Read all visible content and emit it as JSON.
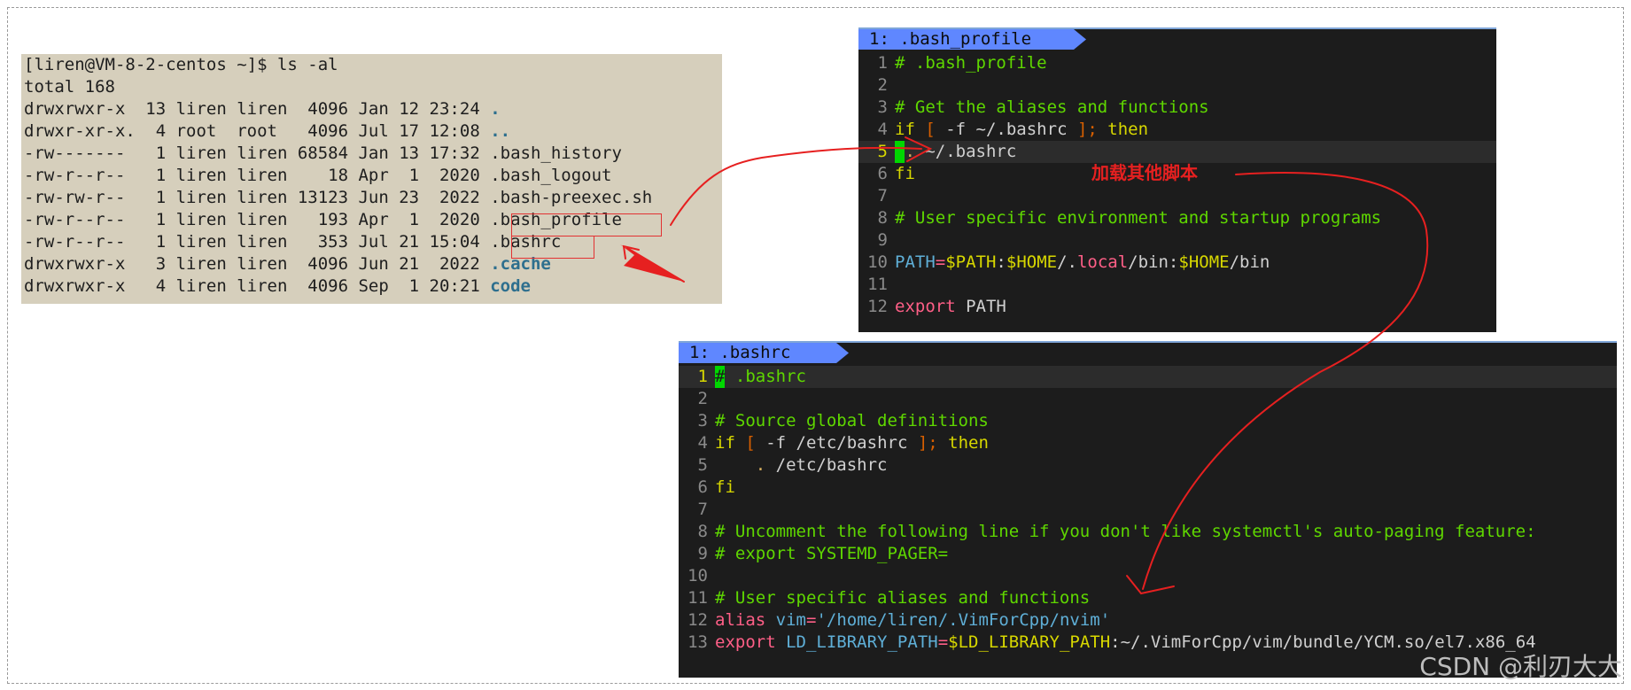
{
  "terminal": {
    "lines": [
      {
        "text": "[liren@VM-8-2-centos ~]$ ls -al",
        "name": ""
      },
      {
        "text": "total 168",
        "name": ""
      },
      {
        "text": "drwxrwxr-x  13 liren liren  4096 Jan 12 23:24 ",
        "name": ".",
        "dir": true
      },
      {
        "text": "drwxr-xr-x.  4 root  root   4096 Jul 17 12:08 ",
        "name": "..",
        "dir": true
      },
      {
        "text": "-rw-------   1 liren liren 68584 Jan 13 17:32 ",
        "name": ".bash_history"
      },
      {
        "text": "-rw-r--r--   1 liren liren    18 Apr  1  2020 ",
        "name": ".bash_logout"
      },
      {
        "text": "-rw-rw-r--   1 liren liren 13123 Jun 23  2022 ",
        "name": ".bash-preexec.sh"
      },
      {
        "text": "-rw-r--r--   1 liren liren   193 Apr  1  2020 ",
        "name": ".bash_profile"
      },
      {
        "text": "-rw-r--r--   1 liren liren   353 Jul 21 15:04 ",
        "name": ".bashrc"
      },
      {
        "text": "drwxrwxr-x   3 liren liren  4096 Jun 21  2022 ",
        "name": ".cache",
        "dir": true
      },
      {
        "text": "drwxrwxr-x   4 liren liren  4096 Sep  1 20:21 ",
        "name": "code",
        "dir": true
      }
    ]
  },
  "vim_profile": {
    "tab": "1: .bash_profile",
    "line_numbers": [
      "1",
      "2",
      "3",
      "4",
      "5",
      "6",
      "7",
      "8",
      "9",
      "10",
      "11",
      "12"
    ],
    "l1": "# .bash_profile",
    "l3": "# Get the aliases and functions",
    "l4_if": "if",
    "l4_open": "[",
    "l4_mid": " -f ~/.bashrc ",
    "l4_close": "];",
    "l4_then": "then",
    "l5_dot": ".",
    "l5_path": " ~/.bashrc",
    "l6": "fi",
    "l8": "# User specific environment and startup programs",
    "l10_path": "PATH",
    "l10_eq": "=",
    "l10_var1": "$PATH",
    "l10_colon": ":",
    "l10_var2": "$HOME",
    "l10_slash": "/.",
    "l10_local": "local",
    "l10_bin": "/bin:",
    "l10_var3": "$HOME",
    "l10_bin2": "/bin",
    "l12_export": "export",
    "l12_path": " PATH"
  },
  "vim_bashrc": {
    "tab": "1: .bashrc",
    "line_numbers": [
      "1",
      "2",
      "3",
      "4",
      "5",
      "6",
      "7",
      "8",
      "9",
      "10",
      "11",
      "12",
      "13"
    ],
    "l1_hash": "#",
    "l1_rest": " .bashrc",
    "l3": "# Source global definitions",
    "l4_if": "if",
    "l4_open": "[",
    "l4_mid": " -f /etc/bashrc ",
    "l4_close": "];",
    "l4_then": "then",
    "l5_dot": ".",
    "l5_path": " /etc/bashrc",
    "l6": "fi",
    "l8": "# Uncomment the following line if you don't like systemctl's auto-paging feature:",
    "l9": "# export SYSTEMD_PAGER=",
    "l11": "# User specific aliases and functions",
    "l12_alias": "alias",
    "l12_vim": "vim",
    "l12_eq": "=",
    "l12_str": "'/home/liren/.VimForCpp/nvim'",
    "l13_export": "export",
    "l13_var": "LD_LIBRARY_PATH",
    "l13_eq": "=",
    "l13_ref": "$LD_LIBRARY_PATH",
    "l13_rest": ":~/.VimForCpp/vim/bundle/YCM.so/el7.x86_64"
  },
  "annotation": {
    "text": "加载其他脚本",
    "color": "#e62020"
  },
  "watermark": "CSDN @利刃大大"
}
